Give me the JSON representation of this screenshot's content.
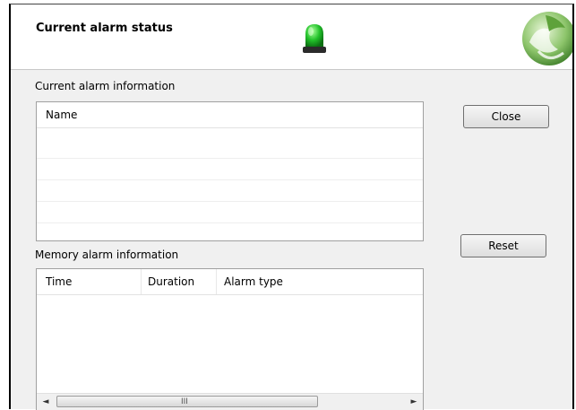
{
  "header": {
    "title": "Current alarm status",
    "status_icon": "green-alarm-beacon-icon",
    "logo_icon": "green-globe-logo-icon"
  },
  "current_alarms": {
    "label": "Current alarm information",
    "columns": [
      "Name"
    ],
    "rows": []
  },
  "memory_alarms": {
    "label": "Memory alarm information",
    "columns": [
      "Time",
      "Duration",
      "Alarm type"
    ],
    "rows": [],
    "scrollbar": {
      "left_arrow": "◄",
      "right_arrow": "►",
      "grip": "III"
    }
  },
  "buttons": {
    "close_label": "Close",
    "reset_label": "Reset"
  },
  "colors": {
    "status_green": "#22c22a",
    "header_bg": "#ffffff",
    "panel_bg": "#f0f0f0"
  }
}
